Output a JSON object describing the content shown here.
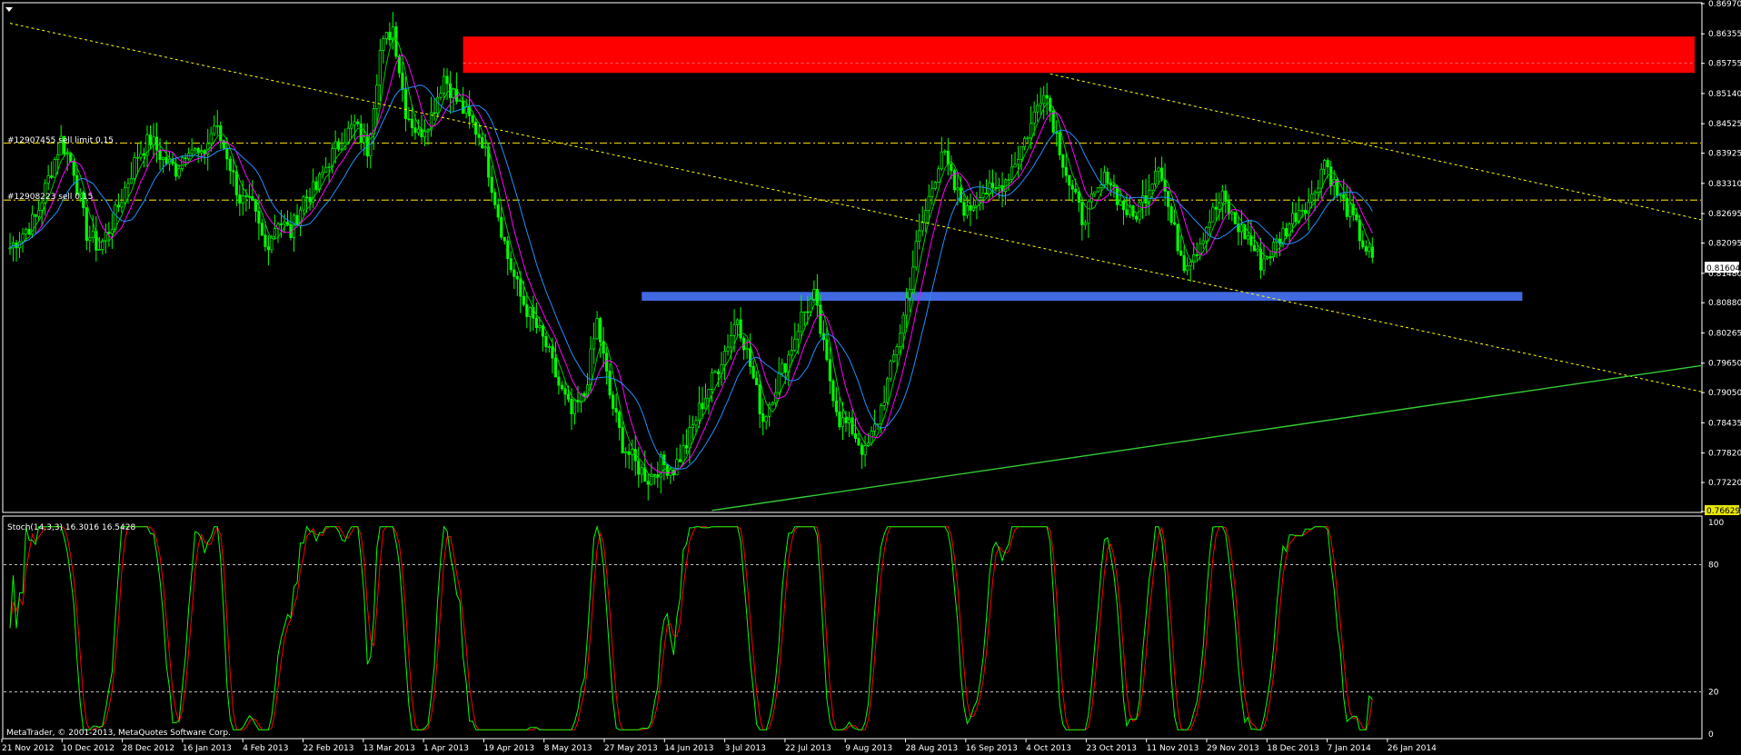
{
  "chart_data": [
    {
      "type": "candlestick",
      "instrument_timeframe": "",
      "colors": {
        "up": "#00ff00",
        "down": "#00ff00",
        "ma_fast": "#ff00ff",
        "ma_slow": "#1e90ff",
        "ma_mid": "#00cc00",
        "trendline": "#ffff00",
        "support_line": "#33cc33"
      },
      "ylim": [
        0.76629,
        0.8697
      ],
      "y_ticks": [
        "0.86970",
        "0.86355",
        "0.85755",
        "0.85140",
        "0.84525",
        "0.83925",
        "0.83310",
        "0.82695",
        "0.82095",
        "0.81480",
        "0.80880",
        "0.80265",
        "0.79650",
        "0.79050",
        "0.78435",
        "0.77820",
        "0.77220",
        "0.76629"
      ],
      "current_price": "0.81604",
      "x_ticks": [
        "21 Nov 2012",
        "10 Dec 2012",
        "28 Dec 2012",
        "16 Jan 2013",
        "4 Feb 2013",
        "22 Feb 2013",
        "13 Mar 2013",
        "1 Apr 2013",
        "19 Apr 2013",
        "8 May 2013",
        "27 May 2013",
        "14 Jun 2013",
        "3 Jul 2013",
        "22 Jul 2013",
        "9 Aug 2013",
        "28 Aug 2013",
        "16 Sep 2013",
        "4 Oct 2013",
        "23 Oct 2013",
        "11 Nov 2013",
        "29 Nov 2013",
        "18 Dec 2013",
        "7 Jan 2014",
        "26 Jan 2014"
      ],
      "close_path": [
        [
          0,
          0.82
        ],
        [
          1,
          0.823
        ],
        [
          2,
          0.826
        ],
        [
          3,
          0.834
        ],
        [
          4,
          0.842
        ],
        [
          5,
          0.836
        ],
        [
          6,
          0.823
        ],
        [
          7,
          0.82
        ],
        [
          8,
          0.825
        ],
        [
          9,
          0.832
        ],
        [
          10,
          0.839
        ],
        [
          11,
          0.842
        ],
        [
          12,
          0.838
        ],
        [
          13,
          0.836
        ],
        [
          14,
          0.841
        ],
        [
          15,
          0.838
        ],
        [
          16,
          0.845
        ],
        [
          17,
          0.839
        ],
        [
          18,
          0.83
        ],
        [
          19,
          0.828
        ],
        [
          20,
          0.82
        ],
        [
          21,
          0.826
        ],
        [
          22,
          0.823
        ],
        [
          23,
          0.83
        ],
        [
          24,
          0.832
        ],
        [
          25,
          0.838
        ],
        [
          26,
          0.842
        ],
        [
          27,
          0.845
        ],
        [
          28,
          0.84
        ],
        [
          29,
          0.86
        ],
        [
          30,
          0.865
        ],
        [
          31,
          0.848
        ],
        [
          32,
          0.843
        ],
        [
          33,
          0.847
        ],
        [
          34,
          0.855
        ],
        [
          35,
          0.85
        ],
        [
          36,
          0.846
        ],
        [
          37,
          0.842
        ],
        [
          38,
          0.83
        ],
        [
          39,
          0.818
        ],
        [
          40,
          0.81
        ],
        [
          41,
          0.805
        ],
        [
          42,
          0.8
        ],
        [
          43,
          0.792
        ],
        [
          44,
          0.786
        ],
        [
          45,
          0.79
        ],
        [
          46,
          0.805
        ],
        [
          47,
          0.79
        ],
        [
          48,
          0.78
        ],
        [
          49,
          0.776
        ],
        [
          50,
          0.773
        ],
        [
          51,
          0.776
        ],
        [
          52,
          0.775
        ],
        [
          53,
          0.78
        ],
        [
          54,
          0.787
        ],
        [
          55,
          0.793
        ],
        [
          56,
          0.799
        ],
        [
          57,
          0.806
        ],
        [
          58,
          0.796
        ],
        [
          59,
          0.785
        ],
        [
          60,
          0.792
        ],
        [
          61,
          0.798
        ],
        [
          62,
          0.806
        ],
        [
          63,
          0.81
        ],
        [
          64,
          0.796
        ],
        [
          65,
          0.785
        ],
        [
          66,
          0.783
        ],
        [
          67,
          0.778
        ],
        [
          68,
          0.785
        ],
        [
          69,
          0.795
        ],
        [
          70,
          0.806
        ],
        [
          71,
          0.82
        ],
        [
          72,
          0.83
        ],
        [
          73,
          0.84
        ],
        [
          74,
          0.832
        ],
        [
          75,
          0.827
        ],
        [
          76,
          0.832
        ],
        [
          77,
          0.831
        ],
        [
          78,
          0.834
        ],
        [
          79,
          0.839
        ],
        [
          80,
          0.845
        ],
        [
          81,
          0.853
        ],
        [
          82,
          0.843
        ],
        [
          83,
          0.833
        ],
        [
          84,
          0.826
        ],
        [
          85,
          0.83
        ],
        [
          86,
          0.835
        ],
        [
          87,
          0.829
        ],
        [
          88,
          0.826
        ],
        [
          89,
          0.831
        ],
        [
          90,
          0.838
        ],
        [
          91,
          0.825
        ],
        [
          92,
          0.817
        ],
        [
          93,
          0.82
        ],
        [
          94,
          0.826
        ],
        [
          95,
          0.83
        ],
        [
          96,
          0.825
        ],
        [
          97,
          0.822
        ],
        [
          98,
          0.817
        ],
        [
          99,
          0.82
        ],
        [
          100,
          0.824
        ],
        [
          101,
          0.828
        ],
        [
          102,
          0.83
        ],
        [
          103,
          0.838
        ],
        [
          104,
          0.831
        ],
        [
          105,
          0.827
        ],
        [
          106,
          0.821
        ],
        [
          107,
          0.816
        ]
      ],
      "zones": [
        {
          "name": "resistance",
          "color": "#ff0000",
          "from": 0.8556,
          "to": 0.863,
          "x_from": 35.5,
          "x_to": 132
        },
        {
          "name": "support",
          "color": "#4169e1",
          "from": 0.8092,
          "to": 0.811,
          "x_from": 49.5,
          "x_to": 118.5
        }
      ],
      "orders": [
        {
          "label": "#12907455 sell limit 0.15",
          "price": 0.8413
        },
        {
          "label": "#12908223 sell 0.15",
          "price": 0.8297
        }
      ],
      "reference_lines": [
        {
          "price": 0.8576
        }
      ],
      "trendlines": [
        {
          "name": "long-downtrend",
          "from": [
            0,
            0.8657
          ],
          "to": [
            132.5,
            0.7907
          ]
        },
        {
          "name": "upper-downtrend",
          "from": [
            81.5,
            0.8554
          ],
          "to": [
            132.5,
            0.8257
          ]
        },
        {
          "name": "rising-support",
          "from": [
            55,
            0.7665
          ],
          "to": [
            132.5,
            0.796
          ]
        }
      ],
      "stochastic": {
        "label": "Stoch(14,3,3) 16.3016 16.5428",
        "params": "14,3,3",
        "main": 16.3016,
        "signal": 16.5428,
        "ylim": [
          0,
          100
        ],
        "levels": [
          20,
          80
        ],
        "y_ticks": [
          "100",
          "80",
          "20",
          "0"
        ],
        "colors": {
          "main": "#00ff00",
          "signal": "#ff0000"
        }
      },
      "copyright": "MetaTrader, © 2001-2013, MetaQuotes Software Corp."
    }
  ]
}
